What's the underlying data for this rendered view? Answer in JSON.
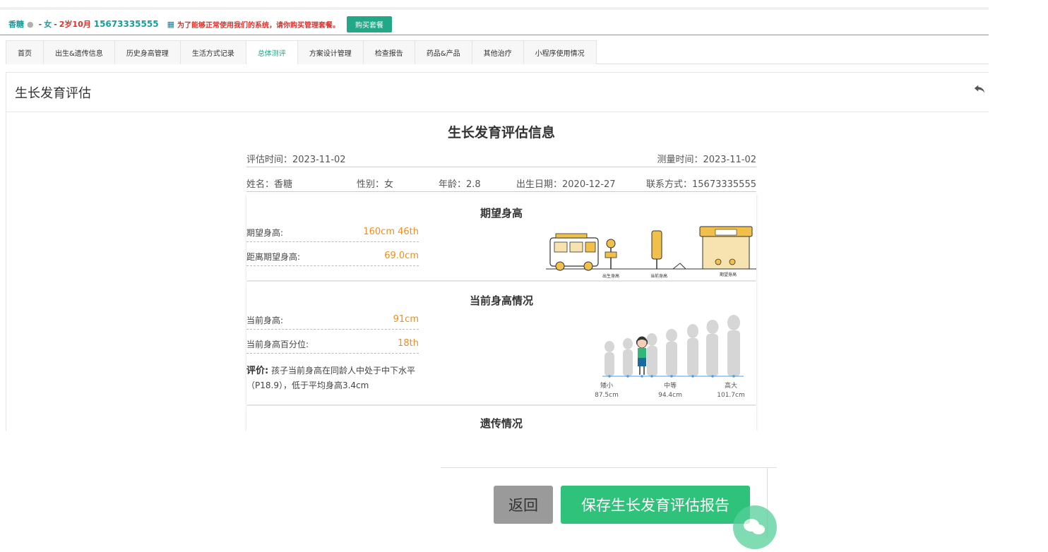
{
  "patient": {
    "name": "香糖",
    "gender": "女",
    "age": "2岁10月",
    "phone": "15673335555",
    "warning": "为了能够正常使用我们的系统，请你购买管理套餐。",
    "buy_label": "购买套餐"
  },
  "tabs": [
    {
      "label": "首页",
      "active": false
    },
    {
      "label": "出生&遗传信息",
      "active": false
    },
    {
      "label": "历史身高管理",
      "active": false
    },
    {
      "label": "生活方式记录",
      "active": false
    },
    {
      "label": "总体测评",
      "active": true
    },
    {
      "label": "方案设计管理",
      "active": false
    },
    {
      "label": "检查报告",
      "active": false
    },
    {
      "label": "药品&产品",
      "active": false
    },
    {
      "label": "其他治疗",
      "active": false
    },
    {
      "label": "小程序使用情况",
      "active": false
    }
  ],
  "panel": {
    "title": "生长发育评估"
  },
  "report": {
    "title": "生长发育评估信息",
    "eval_time": "评估时间：2023-11-02",
    "measure_time": "测量时间：2023-11-02",
    "name": "姓名：香糖",
    "gender": "性别：女",
    "age": "年龄：2.8",
    "birth": "出生日期：2020-12-27",
    "contact": "联系方式：15673335555",
    "expected": {
      "title": "期望身高",
      "rows": [
        {
          "label": "期望身高:",
          "value": "160cm   46th"
        },
        {
          "label": "距离期望身高:",
          "value": "69.0cm"
        }
      ],
      "illus_labels": [
        "出生身高",
        "当前身高",
        "期望身高"
      ]
    },
    "current": {
      "title": "当前身高情况",
      "rows": [
        {
          "label": "当前身高:",
          "value": "91cm"
        },
        {
          "label": "当前身高百分位:",
          "value": "18th"
        }
      ],
      "eval_label": "评价:",
      "eval_text": "孩子当前身高在同龄人中处于中下水平（P18.9），低于平均身高3.4cm",
      "scale": [
        {
          "label": "矮小",
          "value": "87.5cm"
        },
        {
          "label": "中等",
          "value": "94.4cm"
        },
        {
          "label": "高大",
          "value": "101.7cm"
        }
      ]
    },
    "genetic": {
      "title": "遗传情况"
    }
  },
  "footer": {
    "back_label": "返回",
    "save_label": "保存生长发育评估报告"
  },
  "colors": {
    "accent": "#22a887",
    "save": "#2ec27a",
    "value": "#f08c1e",
    "alert": "#e0302a"
  }
}
